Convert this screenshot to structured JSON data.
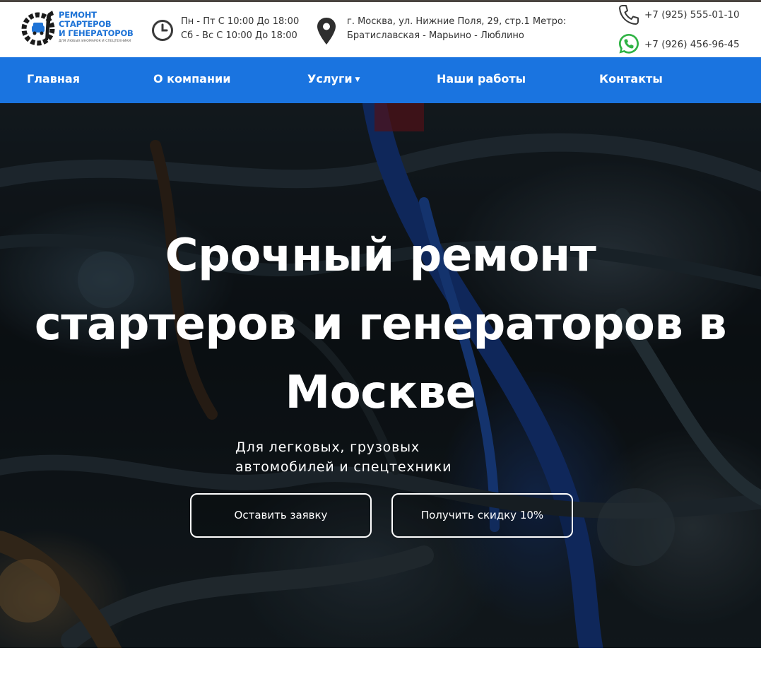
{
  "brand": {
    "line1": "РЕМОНТ",
    "line2": "СТАРТЕРОВ",
    "line3": "И ГЕНЕРАТОРОВ",
    "tagline": "ДЛЯ ЛЮБЫХ ИНОМАРОК И СПЕЦТЕХНИКИ",
    "color": "#1e73d6"
  },
  "hours": {
    "weekdays": "Пн - Пт С 10:00 До 18:00",
    "weekend": "Сб - Вс С 10:00 До 18:00",
    "icon": "clock-icon"
  },
  "address": {
    "line1": "г. Москва, ул. Нижние Поля, 29, стр.1 Метро:",
    "line2": "Братиславская - Марьино - Люблино",
    "icon": "map-pin-icon"
  },
  "contacts": {
    "phone": "+7 (925) 555-01-10",
    "whatsapp": "+7 (926) 456-96-45",
    "phone_icon": "phone-icon",
    "whatsapp_icon": "whatsapp-icon",
    "whatsapp_color": "#2fb344"
  },
  "nav": {
    "color": "#1a74e0",
    "items": [
      {
        "label": "Главная"
      },
      {
        "label": "О компании"
      },
      {
        "label": "Услуги"
      },
      {
        "label": "Наши работы"
      },
      {
        "label": "Контакты"
      }
    ]
  },
  "hero": {
    "title_line1": "Срочный ремонт",
    "title_line2": "стартеров и генераторов в",
    "title_line3": "Москве",
    "subtitle_line1": "Для легковых, грузовых",
    "subtitle_line2": "автомобилей и спецтехники",
    "button_request": "Оставить заявку",
    "button_discount": "Получить скидку 10%"
  }
}
